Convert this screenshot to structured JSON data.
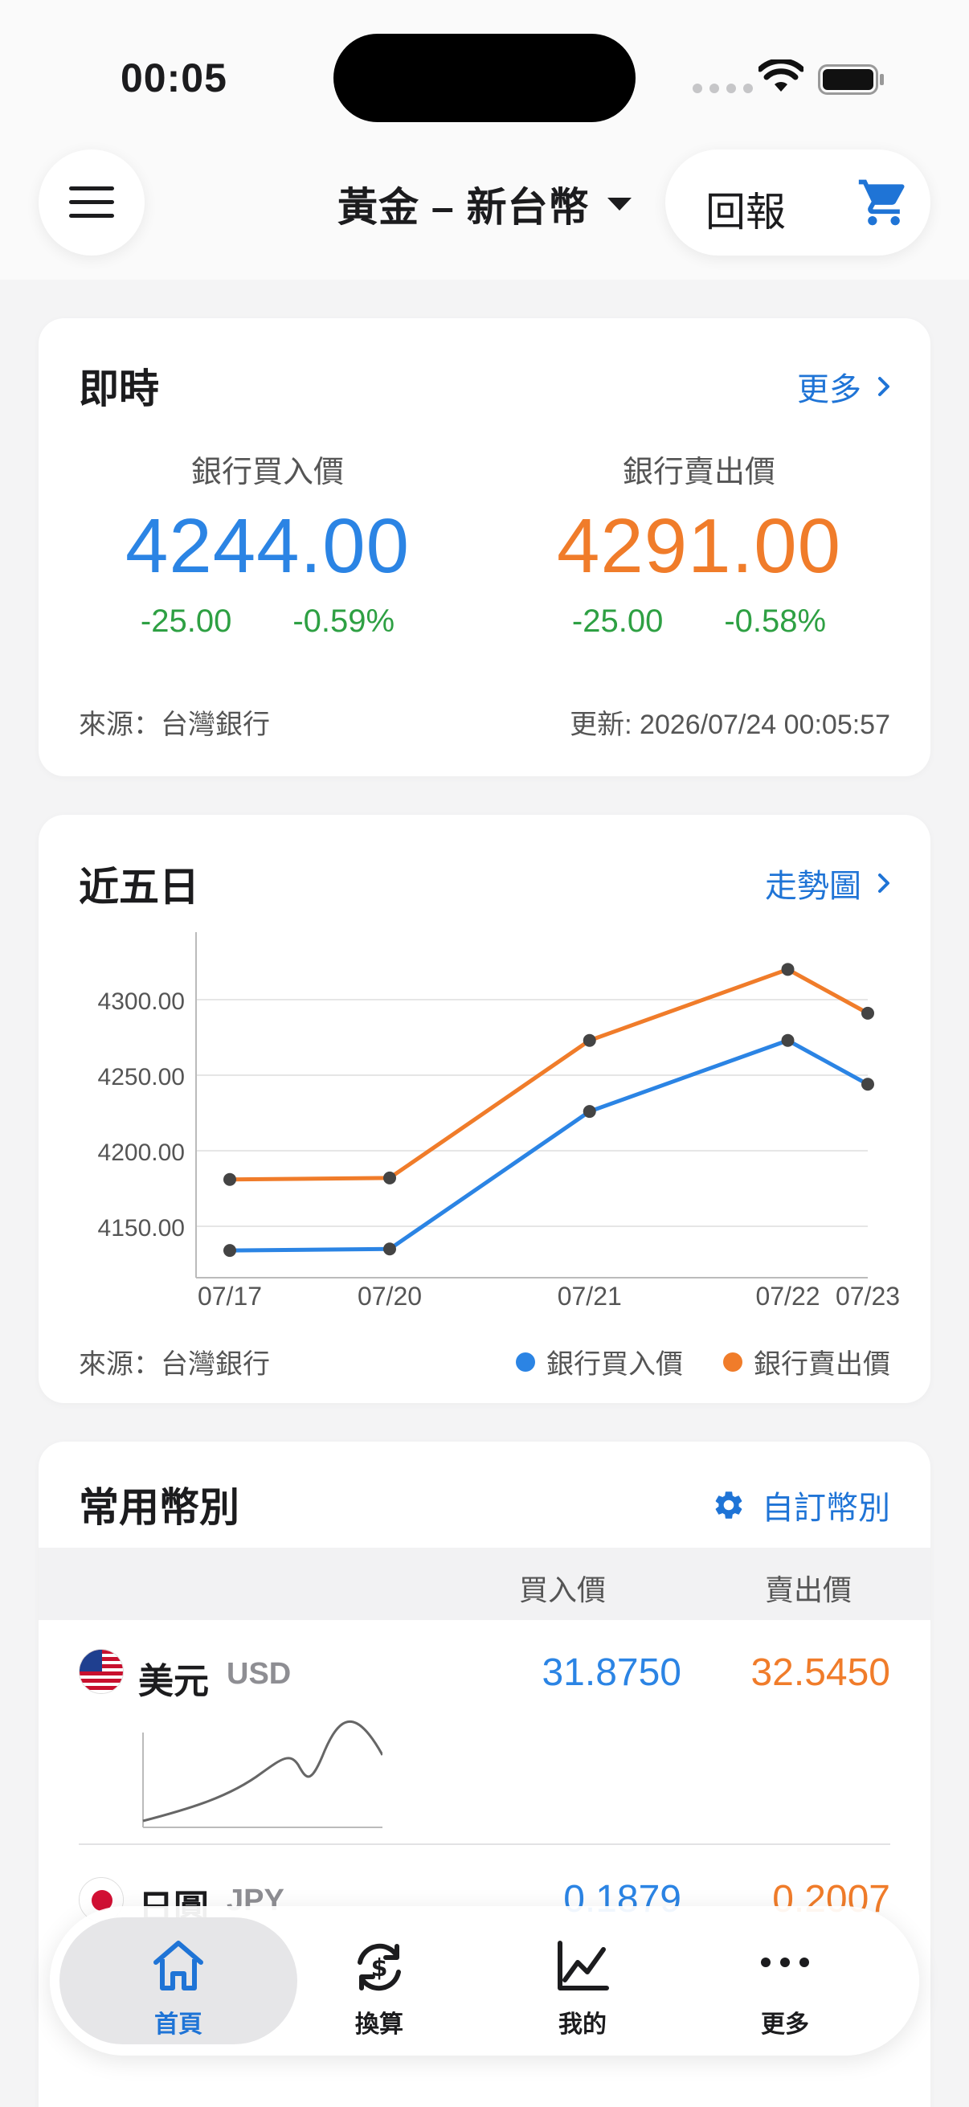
{
  "status": {
    "time": "00:05"
  },
  "header": {
    "title": "黃金 – 新台幣",
    "report_label": "回報"
  },
  "realtime": {
    "title": "即時",
    "more_label": "更多",
    "buy": {
      "label": "銀行買入價",
      "value": "4244.00",
      "change": "-25.00",
      "change_pct": "-0.59%"
    },
    "sell": {
      "label": "銀行賣出價",
      "value": "4291.00",
      "change": "-25.00",
      "change_pct": "-0.58%"
    },
    "source": "來源：台灣銀行",
    "updated": "更新: 2026/07/24 00:05:57"
  },
  "five_day": {
    "title": "近五日",
    "trend_label": "走勢圖",
    "source": "來源：台灣銀行"
  },
  "chart_data": {
    "type": "line",
    "x": [
      "07/17",
      "07/20",
      "07/21",
      "07/22",
      "07/23"
    ],
    "x_positions": [
      0,
      1,
      2.25,
      3.49,
      3.99
    ],
    "yticks": [
      "4150.00",
      "4200.00",
      "4250.00",
      "4300.00"
    ],
    "ylim": [
      4116,
      4334
    ],
    "series": [
      {
        "name": "銀行買入價",
        "color": "#2b84e4",
        "values": [
          4134,
          4135,
          4226,
          4273,
          4244
        ]
      },
      {
        "name": "銀行賣出價",
        "color": "#f07c2a",
        "values": [
          4181,
          4182,
          4273,
          4320,
          4291
        ]
      }
    ],
    "grid": true
  },
  "currencies": {
    "title": "常用幣別",
    "custom_label": "自訂幣別",
    "col_buy": "買入價",
    "col_sell": "賣出價",
    "rows": [
      {
        "name": "美元",
        "code": "USD",
        "buy": "31.8750",
        "sell": "32.5450"
      },
      {
        "name": "日圓",
        "code": "JPY",
        "buy": "0.1879",
        "sell": "0.2007"
      }
    ]
  },
  "colors": {
    "buy": "#2b84e4",
    "sell": "#f07c2a",
    "up_down": "#2ea043",
    "link": "#1f74d6"
  },
  "tabs": [
    {
      "label": "首頁",
      "icon": "home-icon",
      "active": true
    },
    {
      "label": "換算",
      "icon": "exchange-icon",
      "active": false
    },
    {
      "label": "我的",
      "icon": "chart-icon",
      "active": false
    },
    {
      "label": "更多",
      "icon": "more-icon",
      "active": false
    }
  ]
}
